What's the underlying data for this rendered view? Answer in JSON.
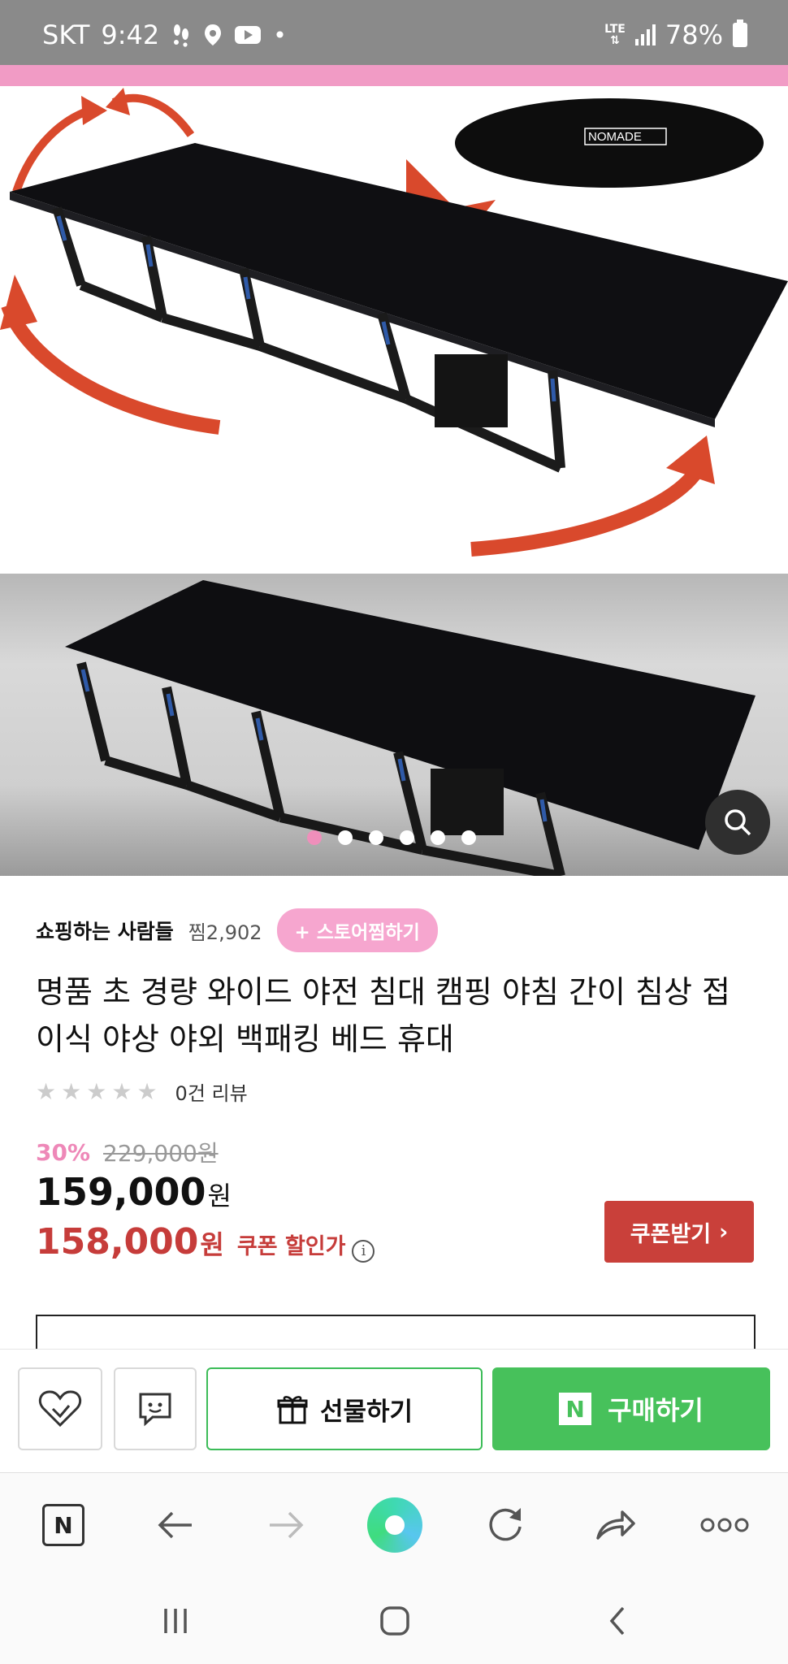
{
  "status_bar": {
    "carrier": "SKT",
    "time": "9:42",
    "network": "LTE",
    "battery": "78%"
  },
  "gallery": {
    "brand_label": "NOMADE",
    "dot_count": 6,
    "active_dot": 1
  },
  "store": {
    "name": "쇼핑하는 사람들",
    "zzim": "찜2,902",
    "follow_label": "+ 스토어찜하기"
  },
  "product": {
    "title": "명품 초 경량 와이드 야전 침대 캠핑 야침 간이 침상 접이식 야상 야외 백패킹 베드 휴대",
    "review_count": "0건 리뷰",
    "rating_stars": 0,
    "discount_rate": "30%",
    "original_price": "229,000원",
    "price": "159,000",
    "price_unit": "원",
    "coupon_price": "158,000",
    "coupon_unit": "원",
    "coupon_label": "쿠폰 할인가",
    "coupon_button": "쿠폰받기"
  },
  "actions": {
    "gift": "선물하기",
    "buy": "구매하기",
    "n_badge": "N"
  },
  "browser": {
    "home_badge": "N"
  },
  "colors": {
    "pink": "#f19bc5",
    "coupon_red": "#c9403a",
    "naver_green": "#47c15b"
  }
}
